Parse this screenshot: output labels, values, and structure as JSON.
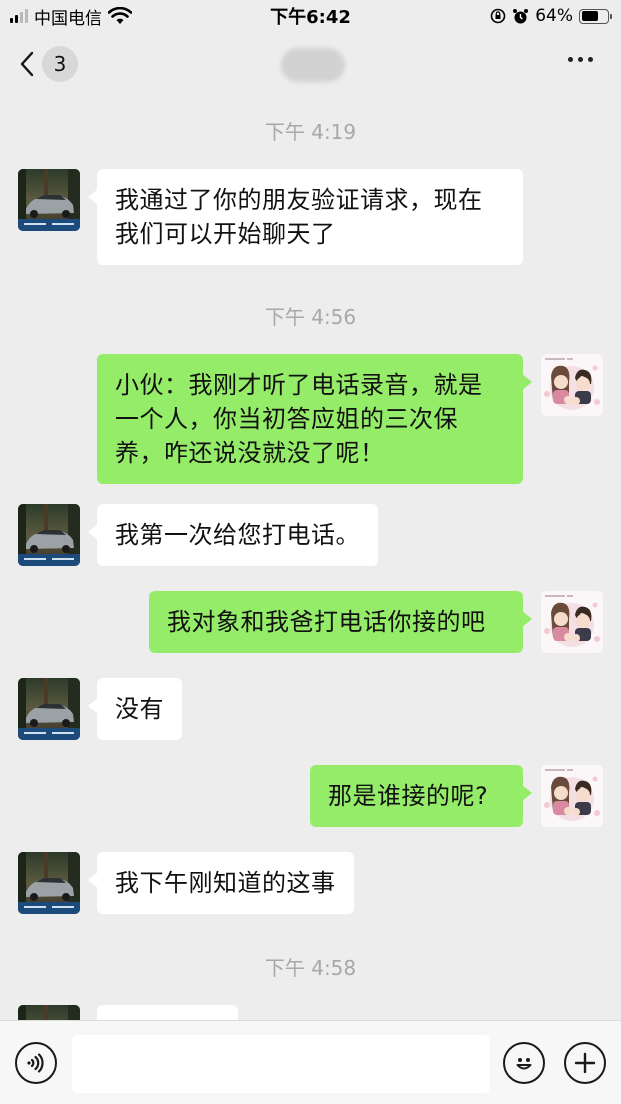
{
  "status_bar": {
    "carrier": "中国电信",
    "time": "下午6:42",
    "battery": "64%",
    "battery_level": 0.64
  },
  "nav": {
    "back_count": "3"
  },
  "colors": {
    "background": "#ededed",
    "incoming_bubble": "#ffffff",
    "outgoing_bubble": "#95ec69",
    "timestamp": "#a8a8a8"
  },
  "messages": [
    {
      "type": "time",
      "text": "下午 4:19"
    },
    {
      "type": "in",
      "text": "我通过了你的朋友验证请求，现在我们可以开始聊天了"
    },
    {
      "type": "time",
      "text": "下午 4:56"
    },
    {
      "type": "out",
      "text": "小伙：我刚才听了电话录音，就是一个人，你当初答应姐的三次保养，咋还说没就没了呢！"
    },
    {
      "type": "in",
      "text": "我第一次给您打电话。"
    },
    {
      "type": "out",
      "text": "我对象和我爸打电话你接的吧"
    },
    {
      "type": "in",
      "text": "没有"
    },
    {
      "type": "out",
      "text": "那是谁接的呢?"
    },
    {
      "type": "in",
      "text": "我下午刚知道的这事"
    },
    {
      "type": "time",
      "text": "下午 4:58"
    },
    {
      "type": "in",
      "text": ""
    }
  ],
  "input": {
    "placeholder": ""
  },
  "icons": {
    "voice": "voice-icon",
    "emoji": "emoji-icon",
    "plus": "plus-icon",
    "back": "chevron-left-icon",
    "more": "more-icon"
  }
}
